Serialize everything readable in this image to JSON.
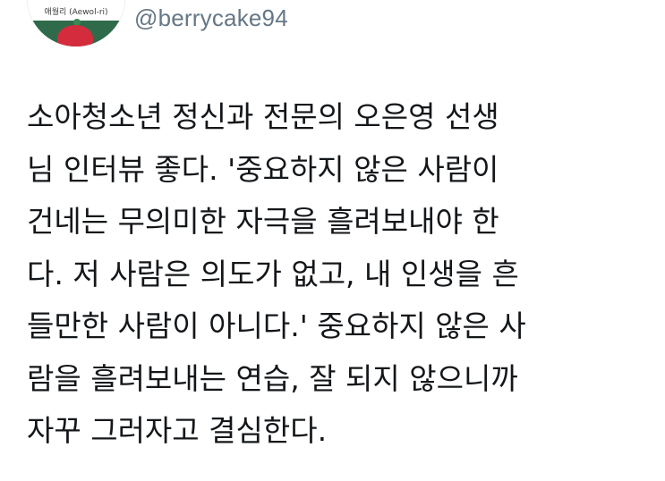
{
  "profile": {
    "avatar_caption": "애월리 (Aewol-ri)",
    "display_name": "",
    "handle": "@berrycake94"
  },
  "tweet": {
    "lines": [
      "소아청소년 정신과 전문의 오은영 선생",
      "님 인터뷰 좋다. '중요하지 않은 사람이",
      "건네는 무의미한 자극을 흘려보내야 한",
      "다. 저 사람은 의도가 없고, 내 인생을 흔",
      "들만한 사람이 아니다.' 중요하지 않은 사",
      "람을 흘려보내는 연습, 잘 되지 않으니까",
      "자꾸 그러자고 결심한다."
    ]
  }
}
